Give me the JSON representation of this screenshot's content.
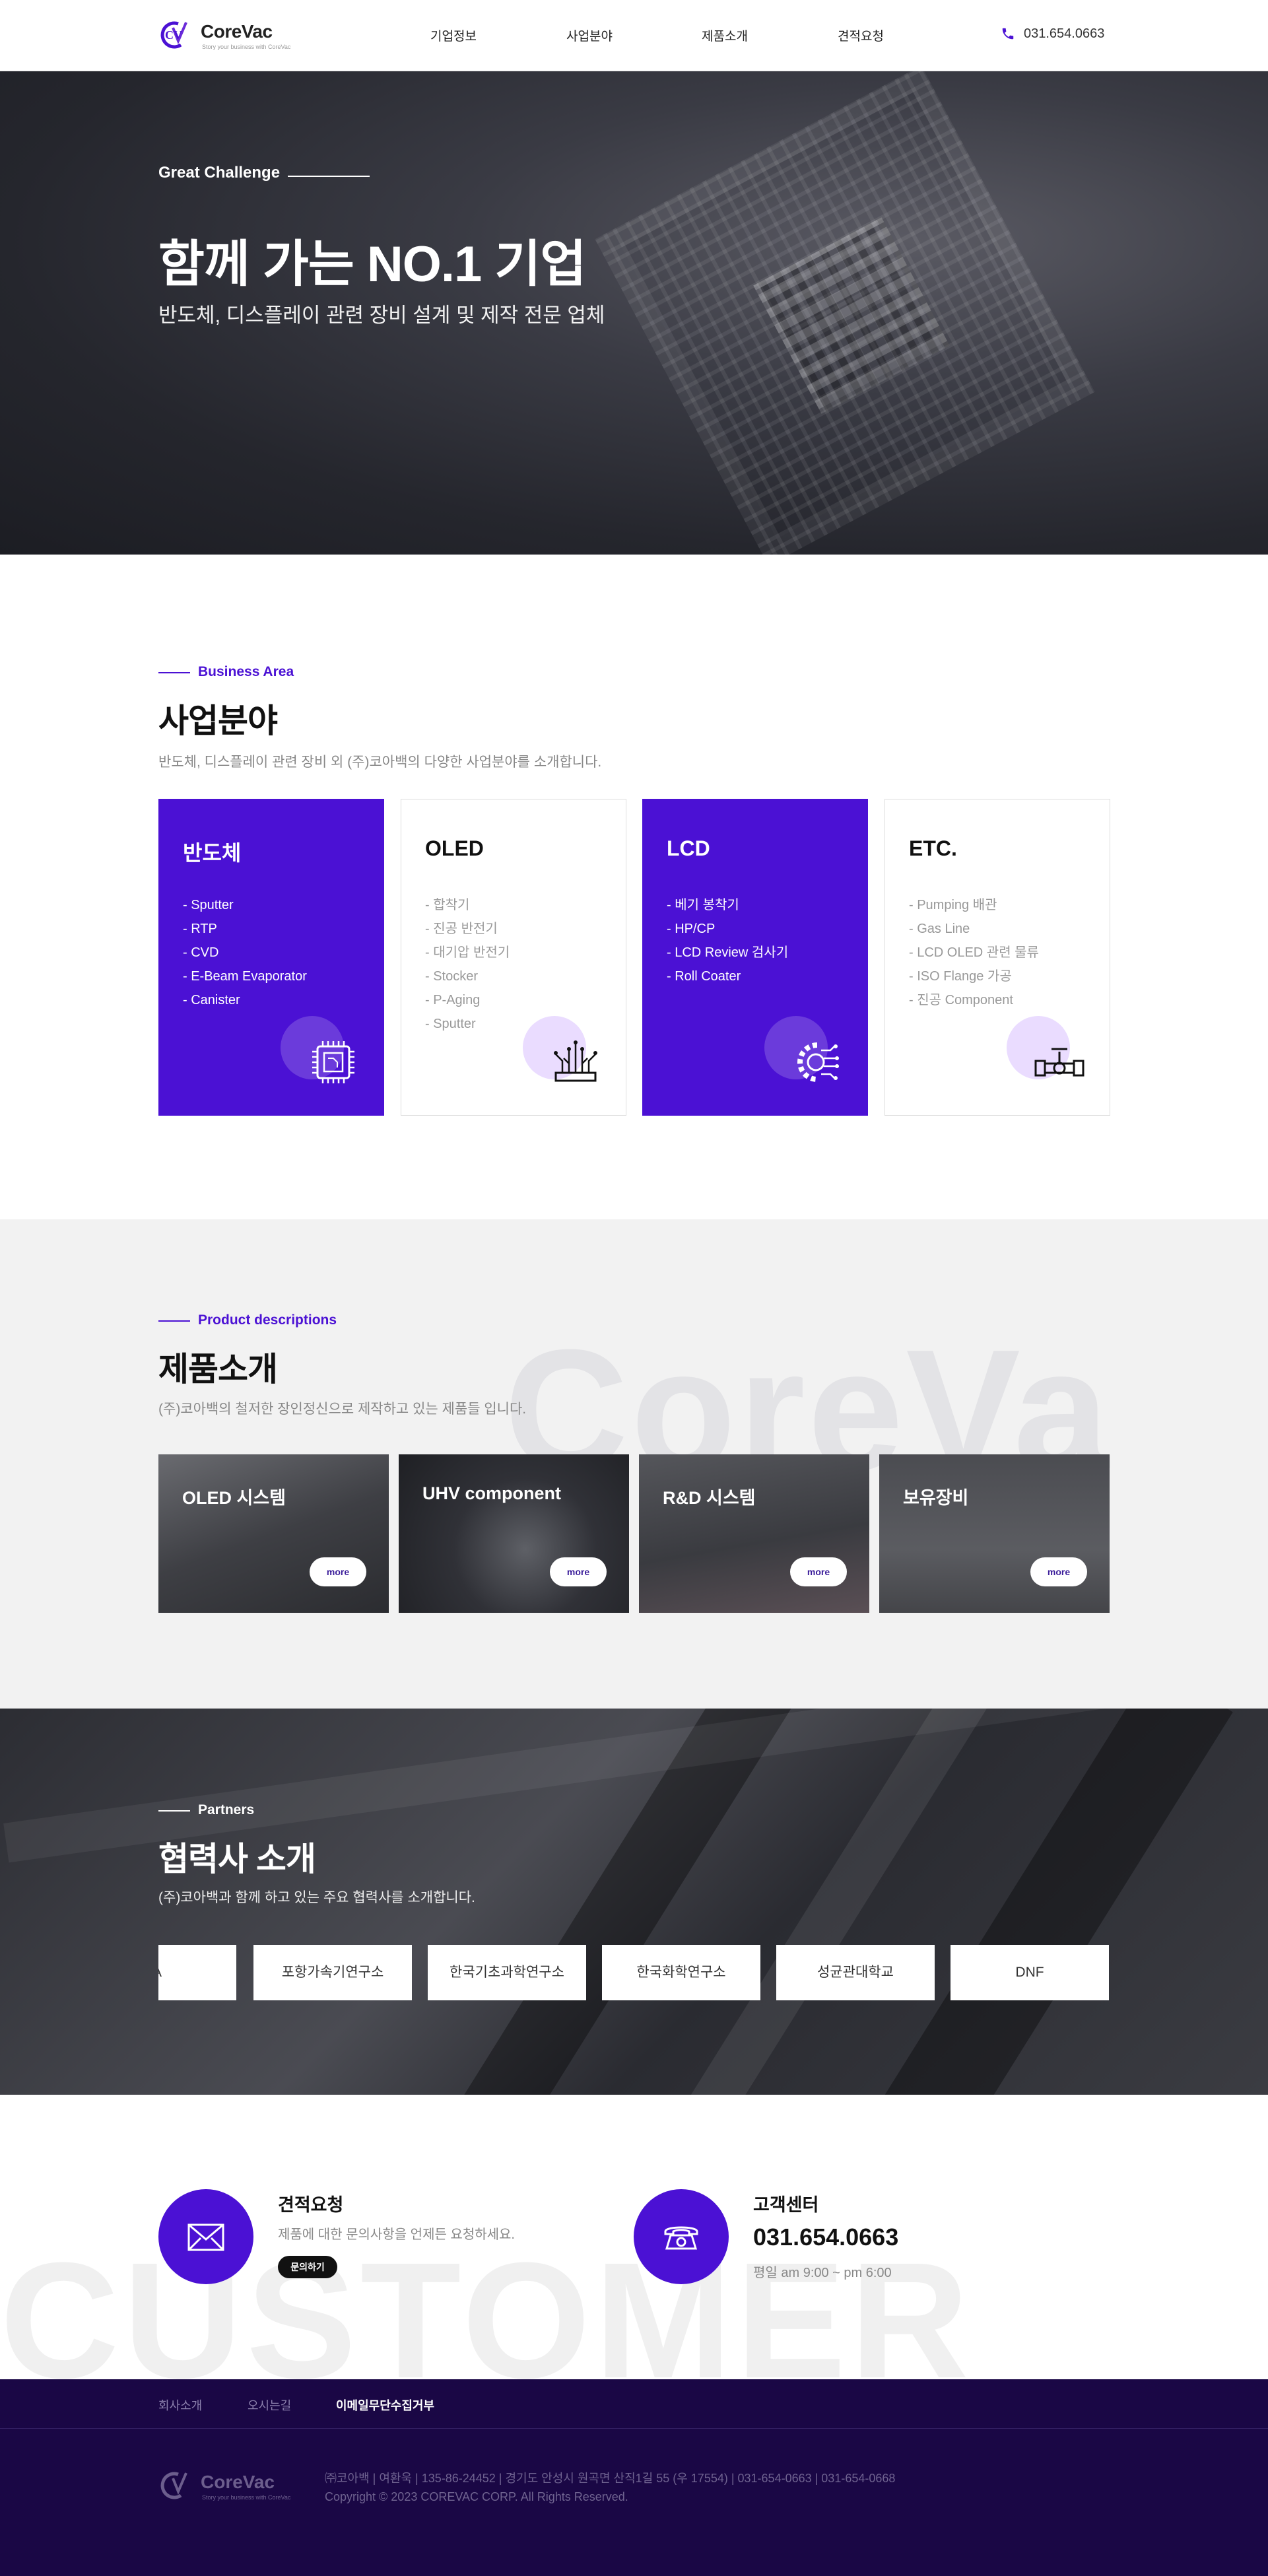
{
  "header": {
    "logo": {
      "mark": "CV",
      "name": "CoreVac",
      "tagline": "Story your business with CoreVac"
    },
    "nav": [
      "기업정보",
      "사업분야",
      "제품소개",
      "견적요청"
    ],
    "phone": "031.654.0663"
  },
  "hero": {
    "eyebrow": "Great Challenge",
    "title": "함께 가는 NO.1 기업",
    "subtitle": "반도체, 디스플레이 관련 장비 설계 및 제작 전문 업체"
  },
  "business": {
    "eyebrow": "Business Area",
    "title": "사업분야",
    "description": "반도체, 디스플레이 관련 장비 외 (주)코아백의 다양한 사업분야를 소개합니다.",
    "cards": [
      {
        "title": "반도체",
        "icon": "chip-icon",
        "items": [
          "- Sputter",
          "- RTP",
          "- CVD",
          "- E-Beam Evaporator",
          "- Canister"
        ]
      },
      {
        "title": "OLED",
        "icon": "circuit-icon",
        "items": [
          "- 합착기",
          "- 진공 반전기",
          "- 대기압 반전기",
          "- Stocker",
          "- P-Aging",
          "- Sputter"
        ]
      },
      {
        "title": "LCD",
        "icon": "gear-network-icon",
        "items": [
          "- 베기 봉착기",
          "- HP/CP",
          "- LCD Review 검사기",
          "- Roll Coater"
        ]
      },
      {
        "title": "ETC.",
        "icon": "valve-pipe-icon",
        "items": [
          "- Pumping 배관",
          "- Gas Line",
          "- LCD OLED 관련 물류",
          "- ISO Flange 가공",
          "- 진공 Component"
        ]
      }
    ]
  },
  "products": {
    "watermark": "CoreVa",
    "eyebrow": "Product descriptions",
    "title": "제품소개",
    "description": "(주)코아백의 철저한 장인정신으로 제작하고 있는 제품들 입니다.",
    "cards": [
      {
        "title": "OLED 시스템",
        "more": "more"
      },
      {
        "title": "UHV component",
        "more": "more"
      },
      {
        "title": "R&D 시스템",
        "more": "more"
      },
      {
        "title": "보유장비",
        "more": "more"
      }
    ]
  },
  "partners": {
    "eyebrow": "Partners",
    "title": "협력사 소개",
    "description": "(주)코아백과 함께 하고 있는 주요 협력사를 소개합니다.",
    "items": [
      "A",
      "포항가속기연구소",
      "한국기초과학연구소",
      "한국화학연구소",
      "성균관대학교",
      "DNF"
    ]
  },
  "customer": {
    "watermark": "CUSTOMER",
    "quote": {
      "title": "견적요청",
      "description": "제품에 대한 문의사항을 언제든 요청하세요.",
      "button": "문의하기",
      "icon": "envelope-icon"
    },
    "center": {
      "title": "고객센터",
      "phone": "031.654.0663",
      "hours": "평일 am 9:00 ~ pm 6:00",
      "icon": "telephone-icon"
    }
  },
  "footer": {
    "links": [
      "회사소개",
      "오시는길",
      "이메일무단수집거부"
    ],
    "info": "㈜코아백 | 여환욱 | 135-86-24452 | 경기도 안성시 원곡면 산직1길 55 (우 17554) | 031-654-0663 | 031-654-0668",
    "copyright": "Copyright © 2023 COREVAC CORP. All Rights Reserved."
  },
  "colors": {
    "brand": "#4b11d4",
    "footer": "#1a0745",
    "card_circle": "#eadcff"
  }
}
